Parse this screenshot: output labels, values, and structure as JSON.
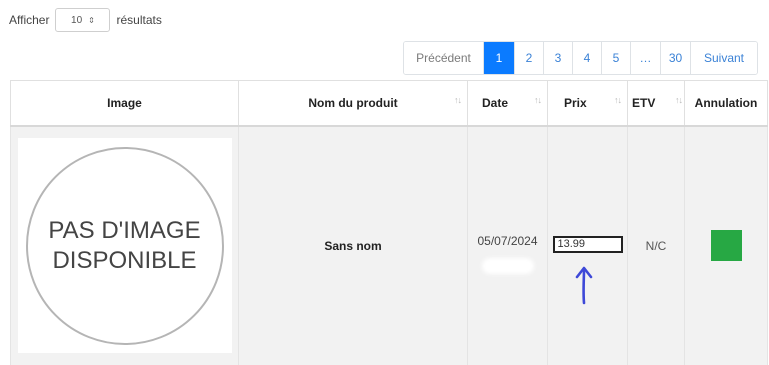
{
  "length_control": {
    "prefix": "Afficher",
    "selected": "10",
    "arrows": "⇕",
    "suffix": "résultats"
  },
  "pagination": {
    "previous": "Précédent",
    "pages": [
      "1",
      "2",
      "3",
      "4",
      "5",
      "…",
      "30"
    ],
    "active_page": "1",
    "next": "Suivant"
  },
  "table": {
    "columns": [
      {
        "label": "Image",
        "sortable": false
      },
      {
        "label": "Nom du produit",
        "sortable": true
      },
      {
        "label": "Date",
        "sortable": true
      },
      {
        "label": "Prix",
        "sortable": true
      },
      {
        "label": "ETV",
        "sortable": true
      },
      {
        "label": "Annulation",
        "sortable": false
      }
    ],
    "sort_glyph": "↑↓",
    "rows": [
      {
        "image_placeholder": "PAS D'IMAGE DISPONIBLE",
        "product_name": "Sans nom",
        "date": "05/07/2024",
        "price": "13.99",
        "etv": "N/C",
        "cancel_color": "#27a844"
      }
    ]
  },
  "colors": {
    "accent": "#0b7bff",
    "link": "#3b82d6",
    "annotation_arrow": "#3e49d8"
  }
}
